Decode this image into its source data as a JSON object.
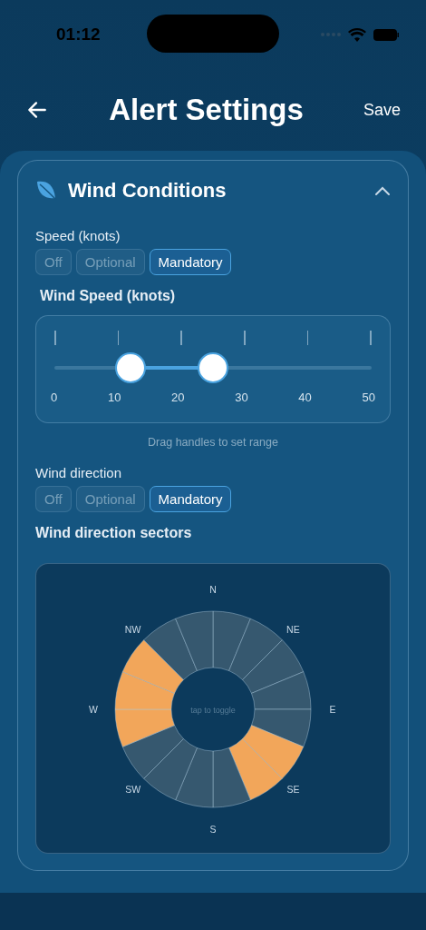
{
  "status_bar": {
    "time": "01:12"
  },
  "header": {
    "title": "Alert Settings",
    "save": "Save"
  },
  "section": {
    "title": "Wind Conditions",
    "expanded": true,
    "speed_mode": {
      "label": "Speed (knots)",
      "options": [
        {
          "label": "Off",
          "selected": false
        },
        {
          "label": "Optional",
          "selected": false
        },
        {
          "label": "Mandatory",
          "selected": true
        }
      ]
    },
    "speed_range": {
      "label": "Wind Speed (knots)",
      "ticks": [
        "0",
        "10",
        "20",
        "30",
        "40",
        "50"
      ],
      "handles": [
        {
          "level": 0.24
        },
        {
          "level": 0.5
        }
      ],
      "hint": "Drag handles to set range"
    },
    "direction_mode": {
      "label": "Wind direction",
      "options": [
        {
          "label": "Off",
          "selected": false
        },
        {
          "label": "Optional",
          "selected": false
        },
        {
          "label": "Mandatory",
          "selected": true
        }
      ]
    },
    "sectors": {
      "label": "Wind direction sectors",
      "center_hint": "tap to toggle",
      "compass": [
        "N",
        "NE",
        "E",
        "SE",
        "S",
        "SW",
        "W",
        "NW"
      ],
      "items": [
        {
          "selected": false
        },
        {
          "selected": false
        },
        {
          "selected": false
        },
        {
          "selected": false
        },
        {
          "selected": false
        },
        {
          "selected": true
        },
        {
          "selected": true
        },
        {
          "selected": false
        },
        {
          "selected": false
        },
        {
          "selected": false
        },
        {
          "selected": false
        },
        {
          "selected": true
        },
        {
          "selected": true
        },
        {
          "selected": true
        },
        {
          "selected": false
        },
        {
          "selected": false
        }
      ]
    }
  }
}
